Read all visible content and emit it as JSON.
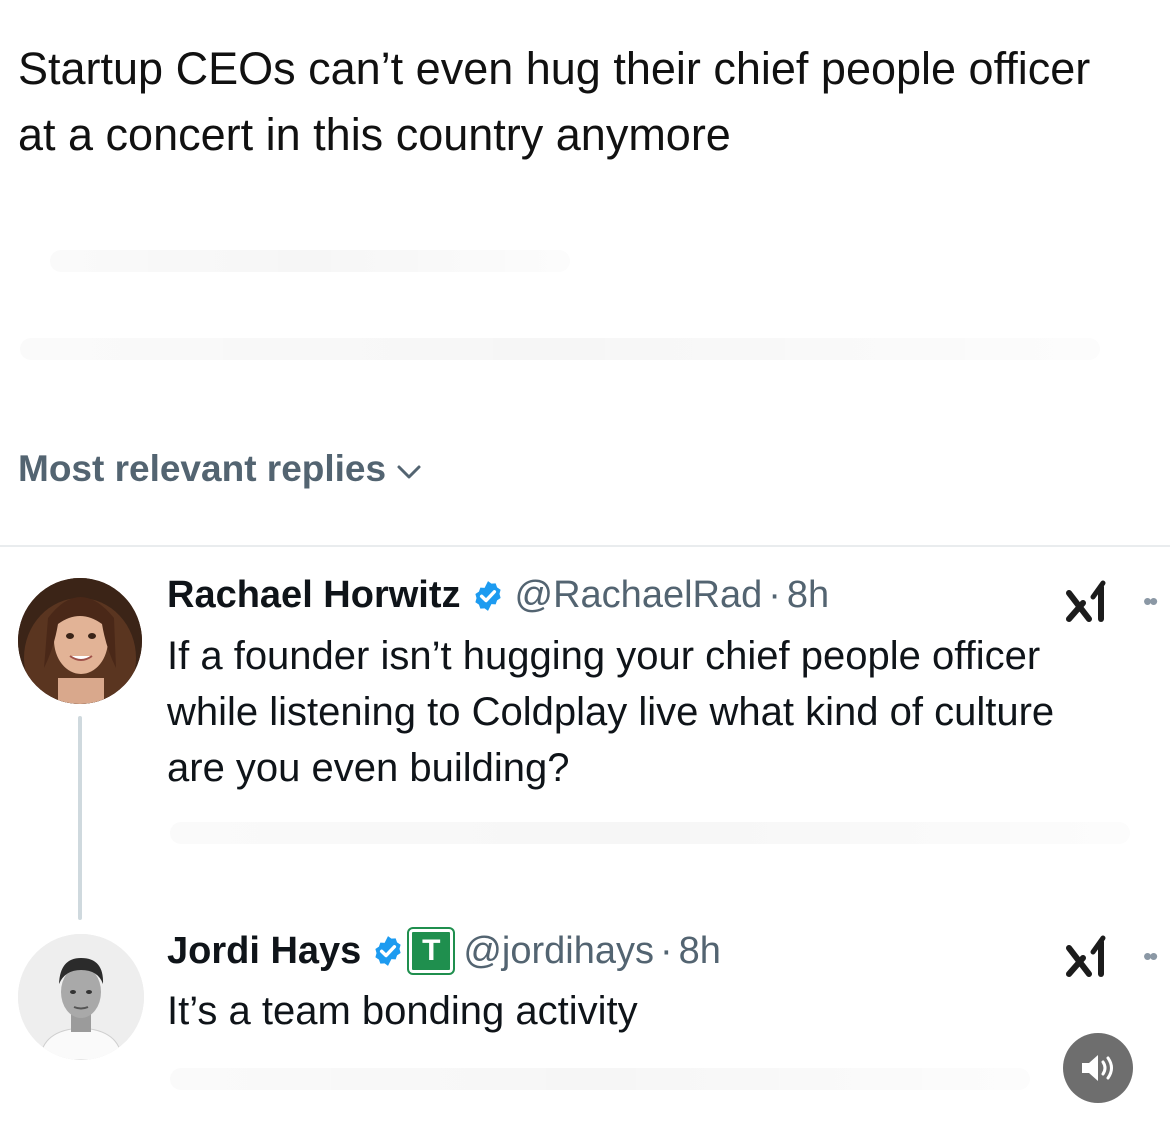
{
  "post": {
    "line1": "Startup CEOs can’t even hug their chief people officer",
    "line2": "at a concert in this country anymore"
  },
  "replies_sort": {
    "label": "Most relevant replies"
  },
  "replies": [
    {
      "name": "Rachael Horwitz",
      "handle": "@RachaelRad",
      "separator": "·",
      "time": "8h",
      "text_lines": [
        "If a founder isn’t hugging your chief people officer",
        "while listening to Coldplay live what kind of culture",
        "are you even building?"
      ]
    },
    {
      "name": "Jordi Hays",
      "org_badge": "T",
      "handle": "@jordihays",
      "separator": "·",
      "time": "8h",
      "text_lines": [
        "It’s a team bonding activity"
      ]
    }
  ],
  "colors": {
    "verified": "#1d9bf0",
    "secondary_text": "#536471",
    "org_badge": "#1f8f4e"
  },
  "icons": {
    "sort": "chevron-down-icon",
    "verified": "verified-badge-icon",
    "grok": "grok-icon",
    "more": "more-dots-icon",
    "sound": "speaker-icon"
  }
}
